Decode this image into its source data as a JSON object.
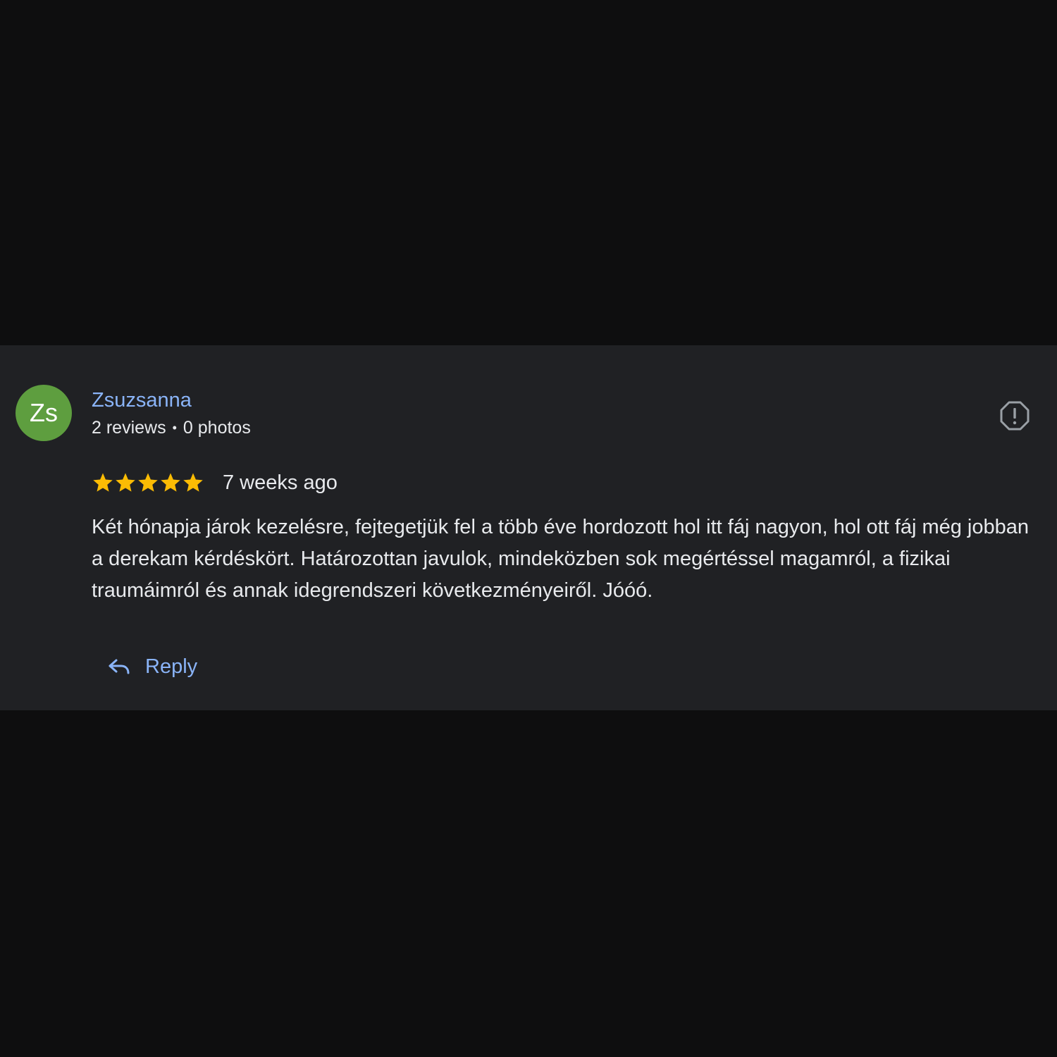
{
  "review": {
    "avatar_initials": "Zs",
    "avatar_color": "#5e9e3f",
    "author_name": "Zsuzsanna",
    "reviews_count": "2 reviews",
    "separator": "•",
    "photos_count": "0 photos",
    "rating": 5,
    "rating_max": 5,
    "star_color": "#fbbc04",
    "date": "7 weeks ago",
    "text": "Két hónapja járok kezelésre, fejtegetjük fel a több éve hordozott hol itt fáj nagyon, hol ott fáj még jobban a derekam kérdéskört. Határozottan javulok, mindeközben sok megértéssel magamról, a fizikai traumáimról és annak idegrendszeri következményeiről. Jóóó.",
    "flag_icon": "report-flag-icon",
    "reply_icon": "reply-arrow-icon",
    "reply_label": "Reply",
    "link_color": "#8ab4f8"
  }
}
